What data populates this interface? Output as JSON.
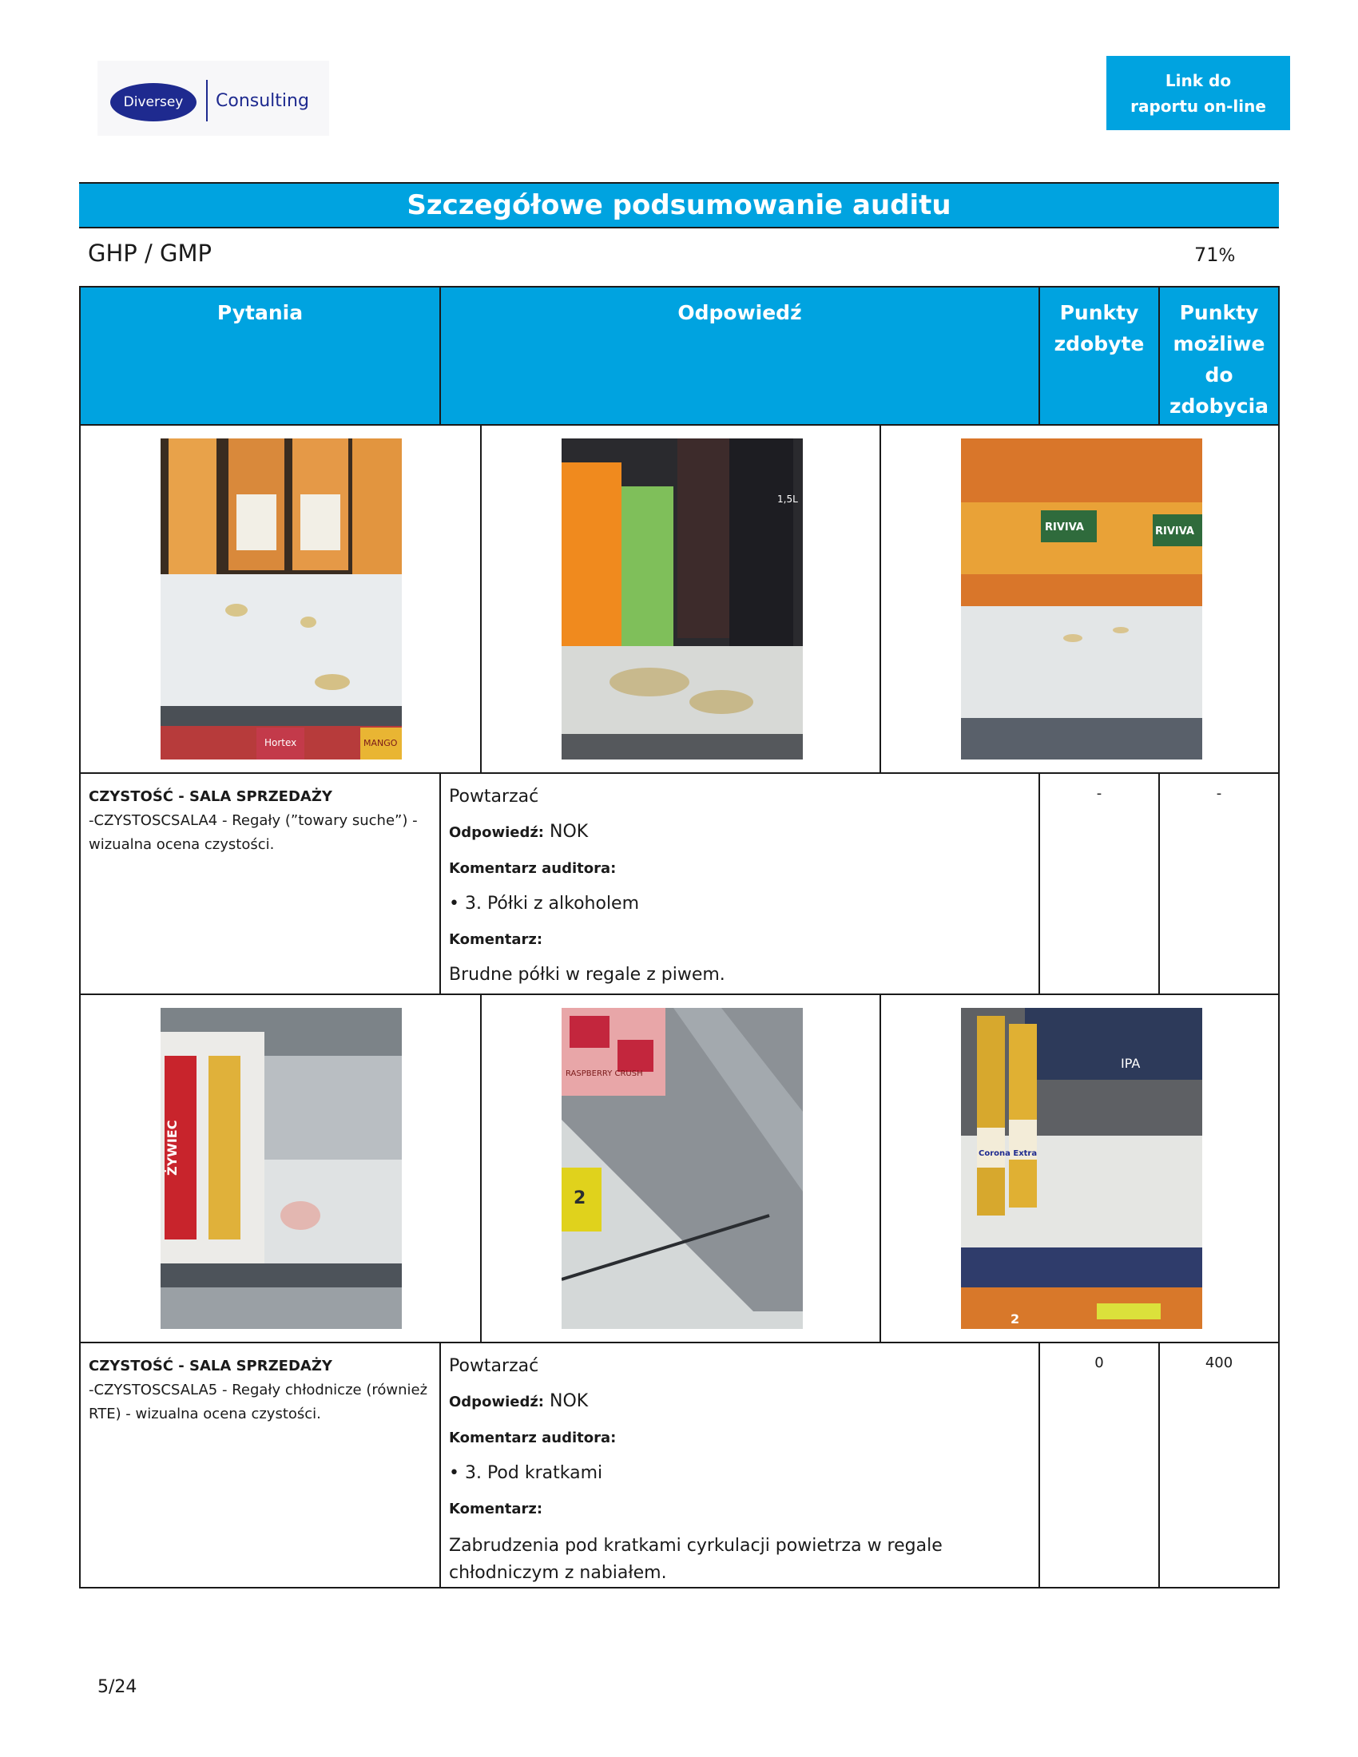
{
  "header": {
    "logo": {
      "brand": "Diversey",
      "brand_suffix": "Consulting"
    },
    "link_button": "Link do raportu on-line"
  },
  "banner_title": "Szczegółowe podsumowanie auditu",
  "section": {
    "name": "GHP / GMP",
    "score": "71",
    "score_unit": "%"
  },
  "table_headers": {
    "question": "Pytania",
    "answer": "Odpowiedź",
    "points_scored": "Punkty zdobyte",
    "points_possible": "Punkty możliwe do zdobycia"
  },
  "labels": {
    "answer": "Odpowiedź:",
    "auditor_comment": "Komentarz auditora:",
    "comment": "Komentarz:"
  },
  "items": [
    {
      "category": "CZYSTOŚĆ - SALA SPRZEDAŻY",
      "question": "-CZYSTOSCSALA4 - Regały (”towary suche”) - wizualna ocena czystości.",
      "repeat": "Powtarzać",
      "answer": "NOK",
      "auditor_comment": "• 3. Półki z alkoholem",
      "comment": "Brudne półki w regale z piwem.",
      "points_scored": "-",
      "points_possible": "-",
      "photos": [
        {
          "name": "juice-shelf-spill-photo",
          "labels": [
            "Hortex",
            "MANGO"
          ]
        },
        {
          "name": "soda-shelf-stain-photo",
          "labels": [
            "1,5L"
          ]
        },
        {
          "name": "riviva-shelf-stain-photo",
          "labels": [
            "RIVIVA",
            "RIVIVA"
          ]
        }
      ]
    },
    {
      "category": "CZYSTOŚĆ - SALA SPRZEDAŻY",
      "question": "-CZYSTOSCSALA5 - Regały chłodnicze (również RTE) - wizualna ocena czystości.",
      "repeat": "Powtarzać",
      "answer": "NOK",
      "auditor_comment": "• 3. Pod kratkami",
      "comment": "Zabrudzenia pod kratkami cyrkulacji powietrza w regale chłodniczym z nabiałem.",
      "points_scored": "0",
      "points_possible": "400",
      "photos": [
        {
          "name": "beer-case-shelf-photo",
          "labels": [
            "ŻYWIEC"
          ]
        },
        {
          "name": "cooler-grate-photo",
          "labels": [
            "RASPBERRY CRUSH",
            "2"
          ]
        },
        {
          "name": "corona-shelf-photo",
          "labels": [
            "Corona Extra",
            "IPA",
            "2"
          ]
        }
      ]
    }
  ],
  "page": "5/24",
  "colors": {
    "accent": "#00a3e0",
    "brand_dark": "#1e2a8f"
  }
}
